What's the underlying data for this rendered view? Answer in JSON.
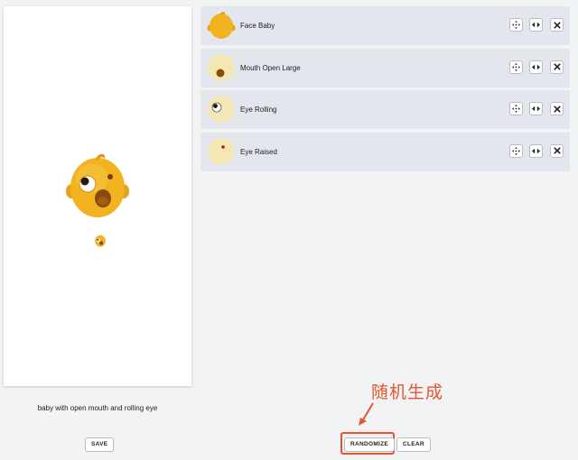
{
  "preview": {
    "caption": "baby with open mouth and rolling eye",
    "save_label": "SAVE"
  },
  "layers": [
    {
      "label": "Face Baby",
      "icon": "face-baby-icon"
    },
    {
      "label": "Mouth Open Large",
      "icon": "mouth-open-large-icon"
    },
    {
      "label": "Eye Rolling",
      "icon": "eye-rolling-icon"
    },
    {
      "label": "Eye Raised",
      "icon": "eye-raised-icon"
    }
  ],
  "layer_tools": [
    "move-icon",
    "flip-horizontal-icon",
    "delete-icon"
  ],
  "actions": {
    "randomize_label": "RANDOMIZE",
    "clear_label": "CLEAR"
  },
  "annotation": {
    "text": "随机生成",
    "color": "#e4572e"
  },
  "colors": {
    "emoji_yellow": "#f3b21f",
    "emoji_dark": "#8a4a0a",
    "thumb_bg": "#f5e7b5",
    "layer_bg": "#e3e6ec"
  }
}
